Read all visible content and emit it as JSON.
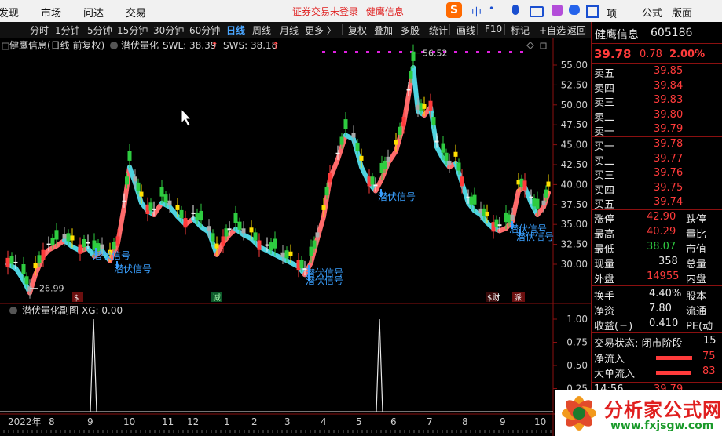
{
  "menu": [
    "发现",
    "市场",
    "问达",
    "交易"
  ],
  "notice": "证券交易未登录",
  "notice_stock": "健鹰信息",
  "sogou": {
    "ime_label": "中",
    "punct": "•",
    "menu1": "项",
    "menu2": "公式",
    "menu3": "版面"
  },
  "toolbar": [
    "分时",
    "1分钟",
    "5分钟",
    "15分钟",
    "30分钟",
    "60分钟",
    "日线",
    "周线",
    "月线",
    "更多 〉",
    "复权",
    "叠加",
    "多股",
    "统计",
    "画线",
    "F10",
    "标记",
    "+自选",
    "返回"
  ],
  "toolbar_active": "日线",
  "chart_header": {
    "name": "健鹰信息(日线 前复权)",
    "indicator": "潜伏量化",
    "swl_label": "SWL: 38.39",
    "sws_label": "SWS: 38.18",
    "arrow": "↑"
  },
  "sub_header": {
    "name": "潜伏量化副图",
    "xg": "XG: 0.00"
  },
  "y_axis_main": [
    "55.00",
    "52.50",
    "50.00",
    "47.50",
    "45.00",
    "42.50",
    "40.00",
    "37.50",
    "35.00",
    "32.50",
    "30.00"
  ],
  "y_axis_sub": [
    "1.00",
    "0.75",
    "0.50",
    "0.25"
  ],
  "x_axis": [
    "2022年",
    "8",
    "9",
    "10",
    "11",
    "12",
    "1",
    "2",
    "3",
    "4",
    "5",
    "6",
    "7",
    "8",
    "9",
    "10"
  ],
  "annotations": {
    "high": "56.52",
    "low": "26.99",
    "signal": "潜伏信号"
  },
  "markers": [
    "$",
    "减",
    "$财",
    "派"
  ],
  "quote": {
    "name": "健鹰信息",
    "code": "605186",
    "price": "39.78",
    "change": "0.78",
    "pct": "2.00%",
    "asks": [
      {
        "label": "卖五",
        "price": "39.85"
      },
      {
        "label": "卖四",
        "price": "39.84"
      },
      {
        "label": "卖三",
        "price": "39.83"
      },
      {
        "label": "卖二",
        "price": "39.80"
      },
      {
        "label": "卖一",
        "price": "39.79"
      }
    ],
    "bids": [
      {
        "label": "买一",
        "price": "39.78"
      },
      {
        "label": "买二",
        "price": "39.77"
      },
      {
        "label": "买三",
        "price": "39.76"
      },
      {
        "label": "买四",
        "price": "39.75"
      },
      {
        "label": "买五",
        "price": "39.74"
      }
    ],
    "stats": [
      {
        "label": "涨停",
        "value": "42.90",
        "label2": "跌停"
      },
      {
        "label": "最高",
        "value": "40.29",
        "label2": "量比"
      },
      {
        "label": "最低",
        "value": "38.07",
        "label2": "市值"
      },
      {
        "label": "现量",
        "value": "358",
        "label2": "总量"
      },
      {
        "label": "外盘",
        "value": "14955",
        "label2": "内盘"
      }
    ],
    "stats2": [
      {
        "label": "换手",
        "value": "4.40%",
        "label2": "股本"
      },
      {
        "label": "净资",
        "value": "7.80",
        "label2": "流通"
      },
      {
        "label": "收益(三)",
        "value": "0.410",
        "label2": "PE(动"
      }
    ],
    "trade_status": "交易状态: 闭市阶段",
    "trade_status_tail": "15",
    "flows": [
      {
        "label": "净流入",
        "value": "75"
      },
      {
        "label": "大单流入",
        "value": "83"
      }
    ],
    "last_time": "14:56",
    "last_price": "39.79"
  },
  "watermark": {
    "title": "分析家公式网",
    "url": "www.fxjsgw.com"
  },
  "chart_data": {
    "type": "candlestick",
    "title": "健鹰信息(日线 前复权)",
    "ylim": [
      26,
      57.5
    ],
    "high_label": 56.52,
    "low_label": 26.99,
    "signal_spikes_sub": [
      1.0,
      1.0
    ]
  }
}
